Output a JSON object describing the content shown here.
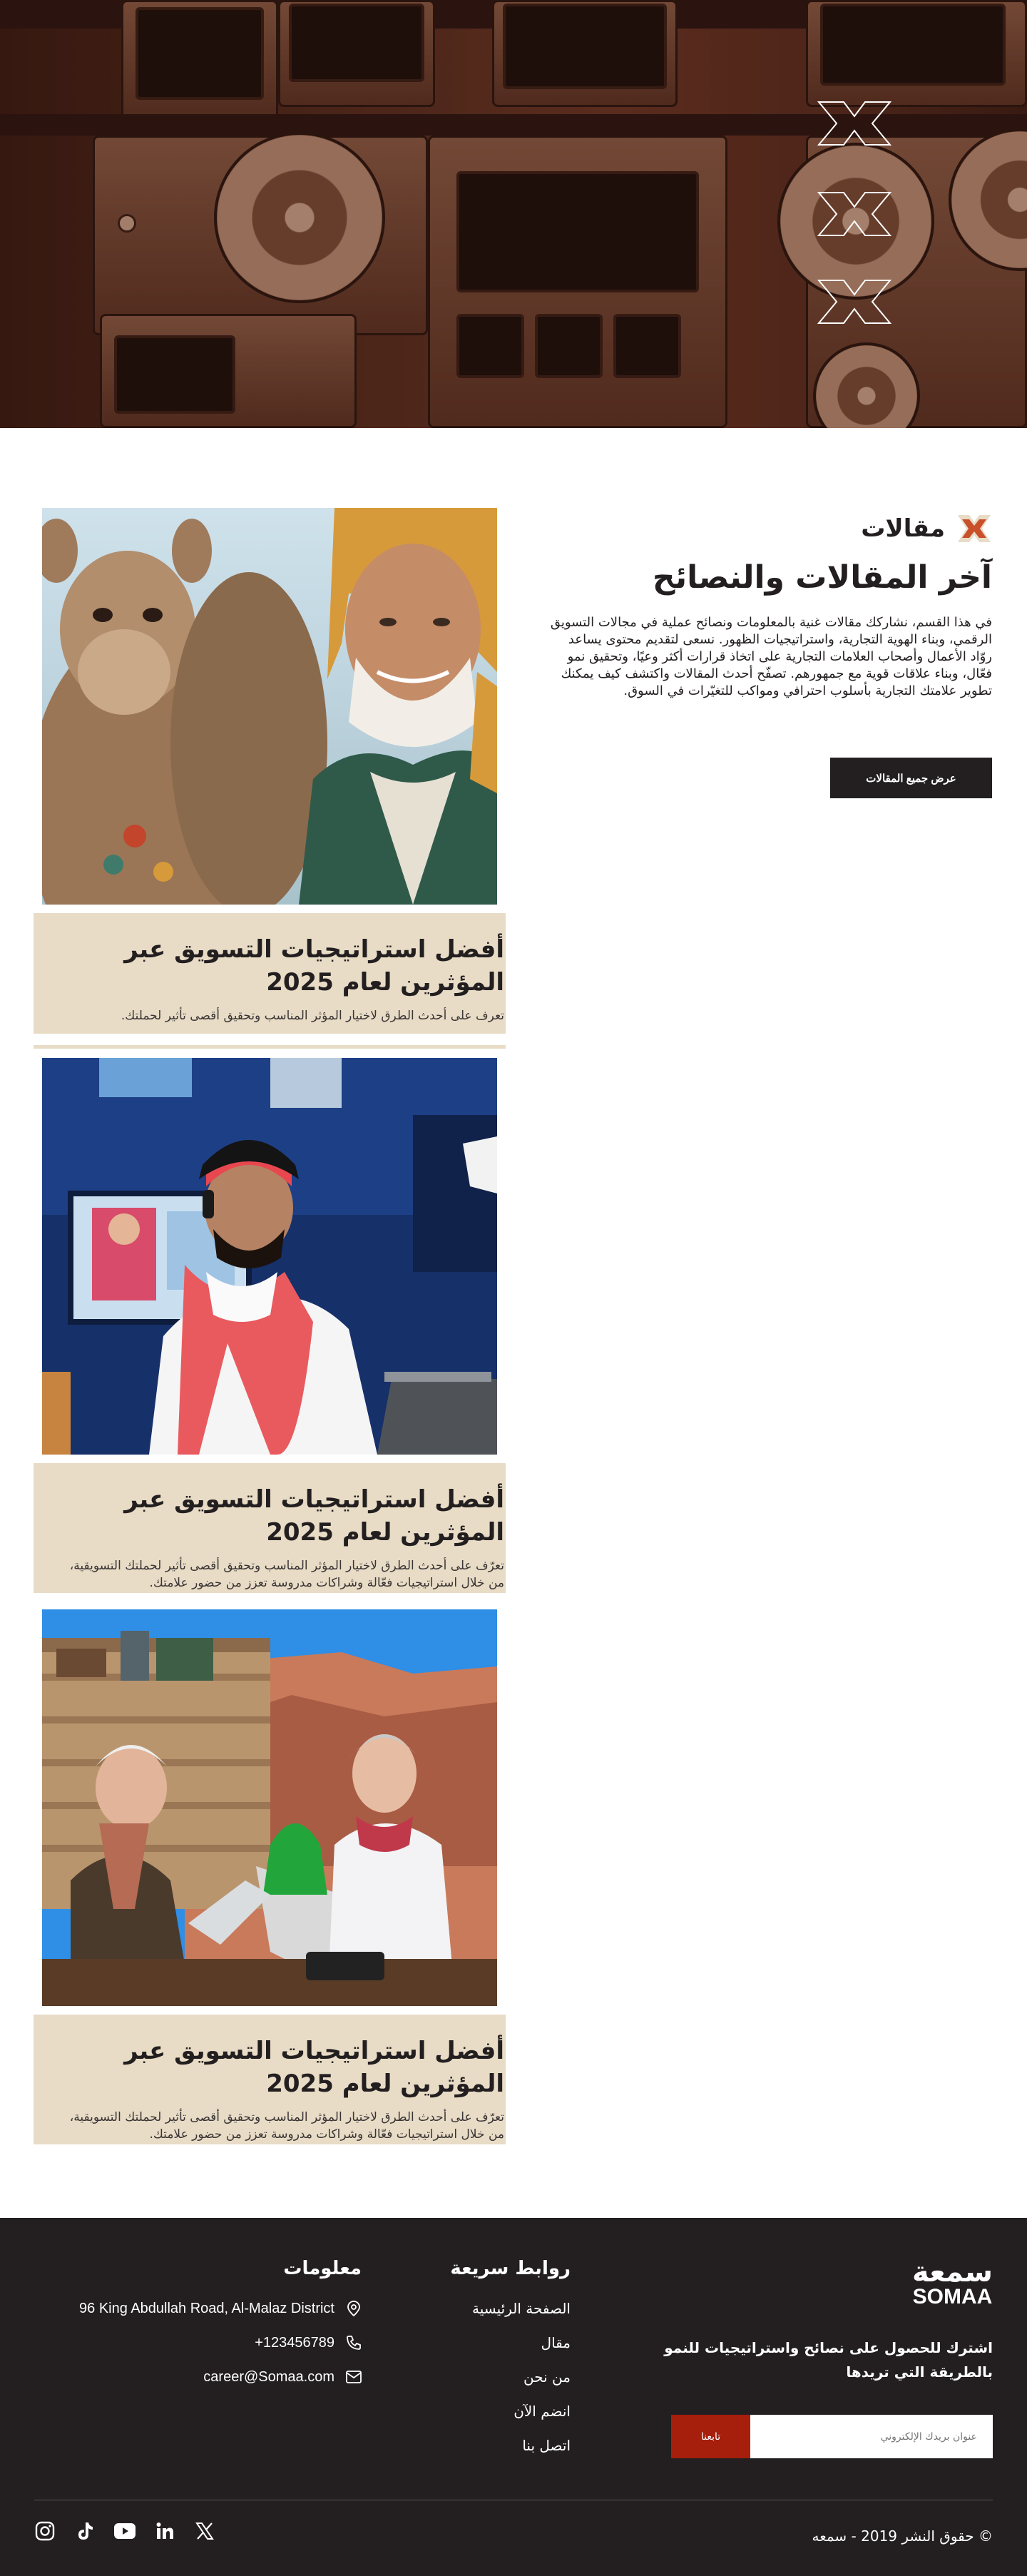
{
  "articles_section": {
    "label": "مقالات",
    "title": "آخر المقالات والنصائح",
    "description": "في هذا القسم، نشاركك مقالات غنية بالمعلومات ونصائح عملية في مجالات التسويق الرقمي، وبناء الهوية التجارية، واستراتيجيات الظهور. نسعى لتقديم محتوى يساعد روّاد الأعمال وأصحاب العلامات التجارية على اتخاذ قرارات أكثر وعيًا، وتحقيق نمو فعّال، وبناء علاقات قوية مع جمهورهم. تصفّح أحدث المقالات واكتشف كيف يمكنك تطوير علامتك التجارية بأسلوب احترافي ومواكب للتغيّرات في السوق.",
    "view_all_label": "عرض جميع المقالات"
  },
  "articles": [
    {
      "title": "أفضل استراتيجيات التسويق عبر المؤثرين لعام 2025",
      "excerpt": "تعرف على أحدث الطرق لاختيار المؤثر المناسب وتحقيق أقصى تأثير لحملتك.",
      "image": "elder-with-camel-photo"
    },
    {
      "title": "أفضل استراتيجيات التسويق عبر المؤثرين لعام 2025",
      "excerpt": "تعرّف على أحدث الطرق لاختيار المؤثر المناسب وتحقيق أقصى تأثير لحملتك التسويقية، من خلال استراتيجيات فعّالة وشراكات مدروسة تعزز من حضور علامتك.",
      "image": "man-at-laptop-photo"
    },
    {
      "title": "أفضل استراتيجيات التسويق عبر المؤثرين لعام 2025",
      "excerpt": "تعرّف على أحدث الطرق لاختيار المؤثر المناسب وتحقيق أقصى تأثير لحملتك التسويقية، من خلال استراتيجيات فعّالة وشراكات مدروسة تعزز من حضور علامتك.",
      "image": "elderly-couple-camping-photo"
    }
  ],
  "footer": {
    "logo_ar": "سمعة",
    "logo_en": "SOMAA",
    "newsletter_text": "اشترك للحصول على نصائح واستراتيجيات للنمو بالطريقة التي تريدها",
    "newsletter_placeholder": "عنوان بريدك الإلكتروني",
    "newsletter_button": "تابعنا",
    "quick_links_title": "روابط سريعة",
    "quick_links": [
      "الصفحة الرئيسية",
      "مقال",
      "من نحن",
      "انضم الآن",
      "اتصل بنا"
    ],
    "info_title": "معلومات",
    "address": "96 King Abdullah Road, Al-Malaz District",
    "phone": "+123456789",
    "email": "career@Somaa.com",
    "copyright": "© حقوق النشر 2019 - سمعه",
    "socials": [
      "instagram-icon",
      "tiktok-icon",
      "youtube-icon",
      "linkedin-icon",
      "x-icon"
    ]
  },
  "colors": {
    "dark": "#231f20",
    "beige": "#e8dcc6",
    "accent": "#a61e0c",
    "logo_orange": "#c9502a"
  }
}
